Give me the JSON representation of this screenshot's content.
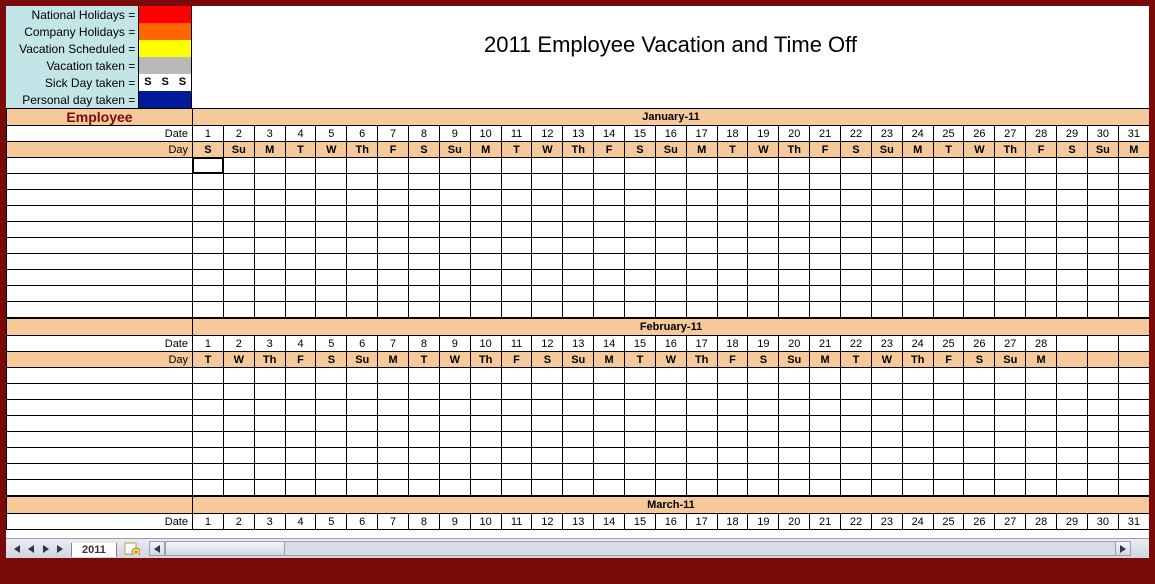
{
  "title": "2011 Employee Vacation and Time Off",
  "legend": {
    "national": {
      "label": "National Holidays =",
      "colors": [
        "red",
        "red",
        "red"
      ]
    },
    "company": {
      "label": "Company Holidays =",
      "colors": [
        "#ff6600",
        "#ff6600",
        "#ff6600"
      ]
    },
    "vacation": {
      "label": "Vacation Scheduled =",
      "colors": [
        "yellow",
        "yellow",
        "yellow"
      ]
    },
    "vtaken": {
      "label": "Vacation taken =",
      "colors": [
        "#b9b9b9",
        "#b9b9b9",
        "#b9b9b9"
      ]
    },
    "sick": {
      "label": "Sick Day taken =",
      "colors": [
        "#ffffff",
        "#ffffff",
        "#ffffff"
      ],
      "marks": [
        "S",
        "S",
        "S"
      ]
    },
    "personal": {
      "label": "Personal day taken =",
      "colors": [
        "#001a99",
        "#001a99",
        "#001a99"
      ]
    }
  },
  "columns": {
    "employee": "Employee",
    "date": "Date",
    "day": "Day"
  },
  "months": [
    {
      "name": "January-11",
      "dates": [
        1,
        2,
        3,
        4,
        5,
        6,
        7,
        8,
        9,
        10,
        11,
        12,
        13,
        14,
        15,
        16,
        17,
        18,
        19,
        20,
        21,
        22,
        23,
        24,
        25,
        26,
        27,
        28,
        29,
        30,
        31
      ],
      "days": [
        "S",
        "Su",
        "M",
        "T",
        "W",
        "Th",
        "F",
        "S",
        "Su",
        "M",
        "T",
        "W",
        "Th",
        "F",
        "S",
        "Su",
        "M",
        "T",
        "W",
        "Th",
        "F",
        "S",
        "Su",
        "M",
        "T",
        "W",
        "Th",
        "F",
        "S",
        "Su",
        "M"
      ],
      "show_emp_header": true,
      "empty_rows": 10,
      "selected_cell": true
    },
    {
      "name": "February-11",
      "dates": [
        1,
        2,
        3,
        4,
        5,
        6,
        7,
        8,
        9,
        10,
        11,
        12,
        13,
        14,
        15,
        16,
        17,
        18,
        19,
        20,
        21,
        22,
        23,
        24,
        25,
        26,
        27,
        28,
        "",
        "",
        ""
      ],
      "days": [
        "T",
        "W",
        "Th",
        "F",
        "S",
        "Su",
        "M",
        "T",
        "W",
        "Th",
        "F",
        "S",
        "Su",
        "M",
        "T",
        "W",
        "Th",
        "F",
        "S",
        "Su",
        "M",
        "T",
        "W",
        "Th",
        "F",
        "S",
        "Su",
        "M",
        "",
        "",
        ""
      ],
      "show_emp_header": false,
      "empty_rows": 8
    },
    {
      "name": "March-11",
      "dates": [
        1,
        2,
        3,
        4,
        5,
        6,
        7,
        8,
        9,
        10,
        11,
        12,
        13,
        14,
        15,
        16,
        17,
        18,
        19,
        20,
        21,
        22,
        23,
        24,
        25,
        26,
        27,
        28,
        29,
        30,
        31
      ],
      "days": [],
      "show_emp_header": false,
      "empty_rows": 0
    }
  ],
  "tab": {
    "name": "2011"
  }
}
